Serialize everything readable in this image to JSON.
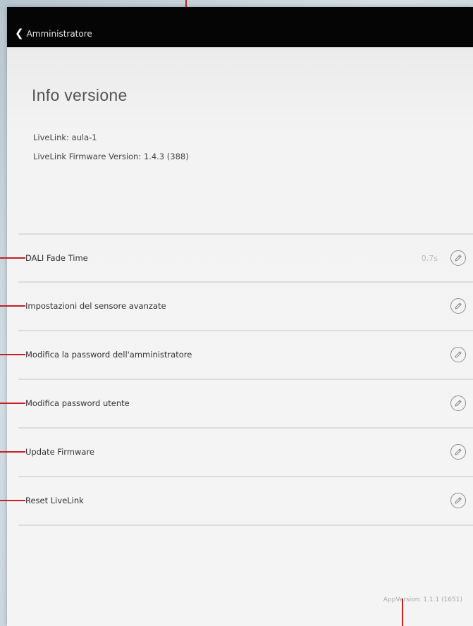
{
  "navbar": {
    "back_label": "Amministratore"
  },
  "info": {
    "title": "Info versione",
    "livelink_name": "LiveLink: aula-1",
    "firmware_version": "LiveLink Firmware Version: 1.4.3 (388)"
  },
  "settings": {
    "items": [
      {
        "label": "DALI Fade Time",
        "value": "0.7s",
        "icon": "pencil-edit-icon"
      },
      {
        "label": "Impostazioni del sensore avanzate",
        "value": "",
        "icon": "pencil-edit-icon"
      },
      {
        "label": "Modifica la password dell'amministratore",
        "value": "",
        "icon": "pencil-edit-icon"
      },
      {
        "label": "Modifica password utente",
        "value": "",
        "icon": "pencil-edit-icon"
      },
      {
        "label": "Update Firmware",
        "value": "",
        "icon": "pencil-edit-icon"
      },
      {
        "label": "Reset LiveLink",
        "value": "",
        "icon": "pencil-edit-icon"
      }
    ]
  },
  "footer": {
    "app_version": "AppVersion: 1.1.1 (1651)"
  },
  "colors": {
    "callout": "#c2202b",
    "navbar": "#050505",
    "background": "#f3f3f3"
  }
}
